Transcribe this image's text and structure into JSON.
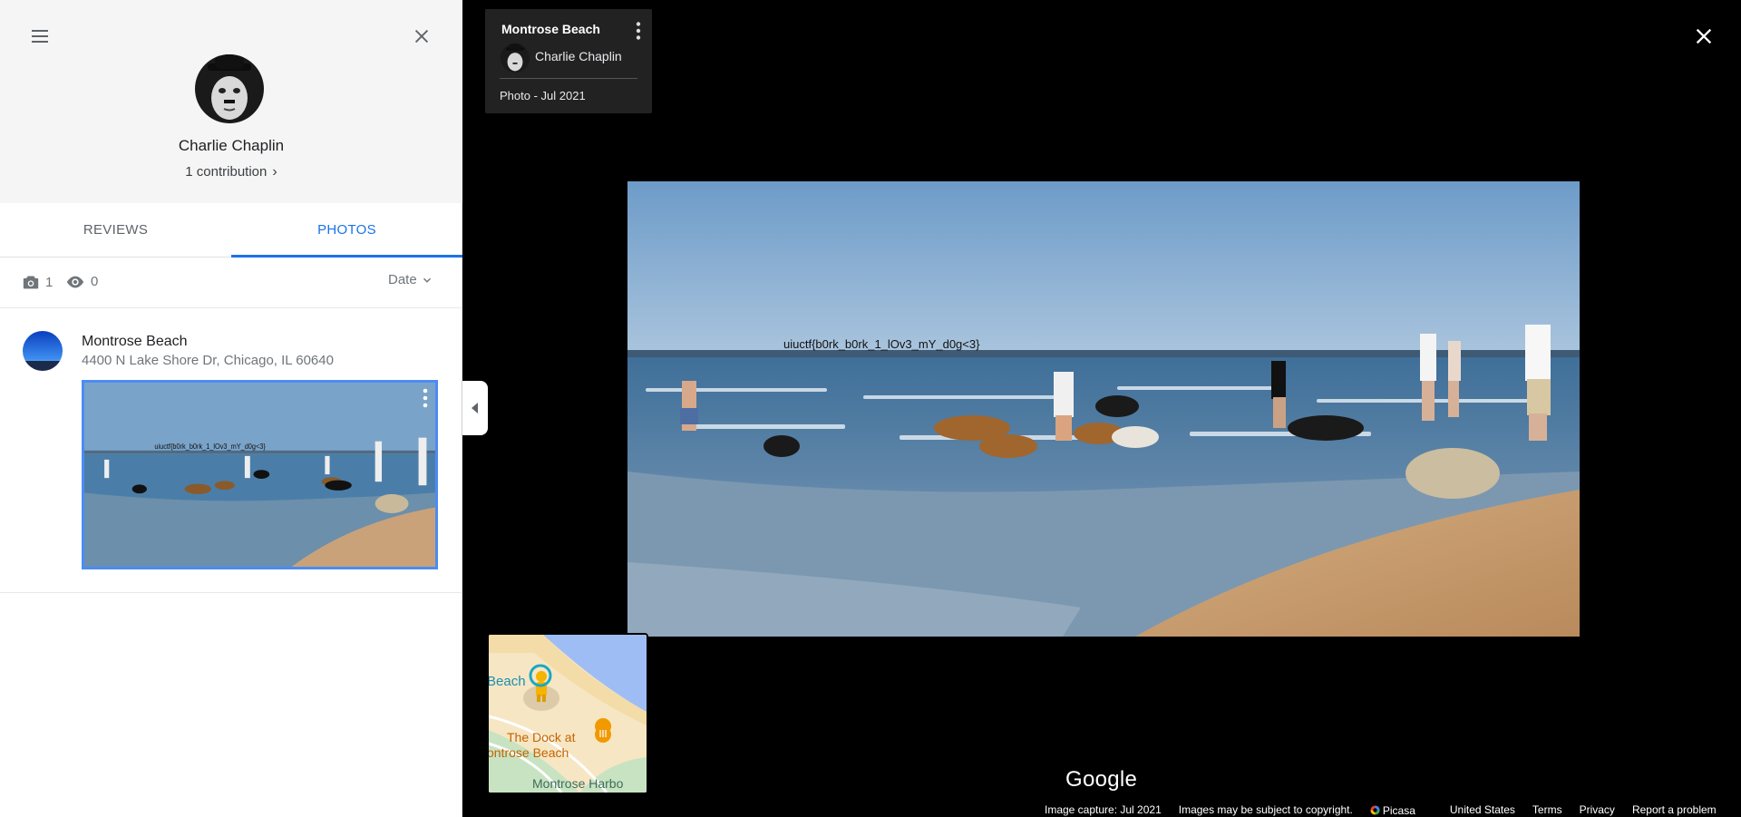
{
  "profile": {
    "name": "Charlie Chaplin",
    "contributions": "1 contribution"
  },
  "tabs": [
    {
      "label": "REVIEWS",
      "active": false
    },
    {
      "label": "PHOTOS",
      "active": true
    }
  ],
  "stats": {
    "photos": "1",
    "views": "0",
    "sort_label": "Date"
  },
  "photo_item": {
    "title": "Montrose Beach",
    "address": "4400 N Lake Shore Dr, Chicago, IL 60640"
  },
  "viewer": {
    "title": "Montrose Beach",
    "author": "Charlie Chaplin",
    "date": "Photo - Jul 2021",
    "photo_caption": "uiuctf{b0rk_b0rk_1_lOv3_mY_d0g<3}",
    "thumb_caption": "uiuctf{b0rk_b0rk_1_lOv3_mY_d0g<3}"
  },
  "minimap": {
    "label_beach": "Beach",
    "label_dock_1": "The Dock at",
    "label_dock_2": "ontrose Beach",
    "label_harbor": "Montrose Harbo"
  },
  "branding": {
    "logo": "Google"
  },
  "footer": {
    "capture": "Image capture: Jul 2021",
    "copyright": "Images may be subject to copyright.",
    "picasa": "Picasa",
    "country": "United States",
    "terms": "Terms",
    "privacy": "Privacy",
    "report": "Report a problem"
  },
  "colors": {
    "accent": "#1a73e8",
    "selection_border": "#4c8bf5",
    "panel_bg": "#f5f5f5",
    "viewer_bg": "#000000"
  },
  "icons": [
    "hamburger-menu-icon",
    "close-icon",
    "camera-icon",
    "eye-icon",
    "chevron-down-icon",
    "more-vert-icon",
    "chevron-left-icon",
    "pegman-icon",
    "restaurant-pin-icon"
  ]
}
